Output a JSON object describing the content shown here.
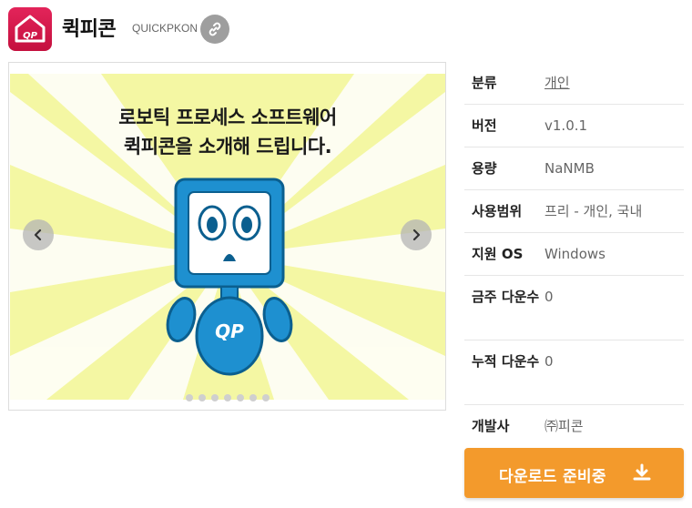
{
  "header": {
    "app_name": "퀵피콘",
    "app_subtitle": "QUICKPKON",
    "icon_text": "QP"
  },
  "carousel": {
    "banner_line1": "로보틱 프로세스 소프트웨어",
    "banner_line2": "퀵피콘을 소개해 드립니다.",
    "mascot_text": "QP",
    "dots": 7
  },
  "info": {
    "rows": [
      {
        "key": "분류",
        "value": "개인",
        "link": true
      },
      {
        "key": "버전",
        "value": "v1.0.1"
      },
      {
        "key": "용량",
        "value": "NaNMB"
      },
      {
        "key": "사용범위",
        "value": "프리 - 개인, 국내"
      },
      {
        "key": "지원 OS",
        "value": "Windows"
      },
      {
        "key": "금주 다운수",
        "value": "0"
      },
      {
        "key": "누적 다운수",
        "value": "0"
      },
      {
        "key": "개발사",
        "value": "㈜피콘"
      }
    ]
  },
  "download": {
    "label": "다운로드 준비중"
  },
  "colors": {
    "brand": "#d81b4e",
    "download": "#f39a2c",
    "slide_bg": "#f4f7a3",
    "mascot": "#1e90d0"
  }
}
